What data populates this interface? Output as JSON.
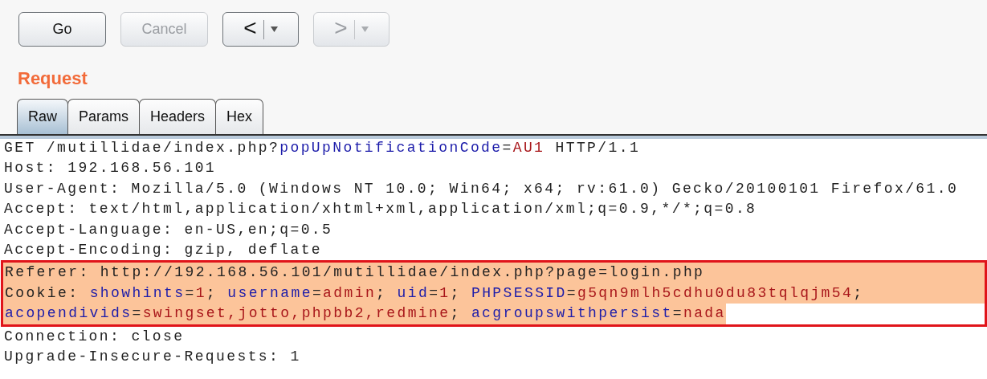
{
  "toolbar": {
    "buttons": [
      {
        "kind": "text",
        "label": "Go",
        "disabled": false
      },
      {
        "kind": "text",
        "label": "Cancel",
        "disabled": true
      },
      {
        "kind": "history",
        "label": "<",
        "disabled": false
      },
      {
        "kind": "history",
        "label": ">",
        "disabled": true
      }
    ]
  },
  "request": {
    "title": "Request",
    "tabs": [
      {
        "label": "Raw",
        "selected": true
      },
      {
        "label": "Params",
        "selected": false
      },
      {
        "label": "Headers",
        "selected": false
      },
      {
        "label": "Hex",
        "selected": false
      }
    ],
    "lines": [
      {
        "segments": [
          {
            "kind": "plain",
            "t": "GET /mutillidae/index.php?"
          },
          {
            "kind": "name",
            "t": "popUpNotificationCode"
          },
          {
            "kind": "plain",
            "t": "="
          },
          {
            "kind": "value",
            "t": "AU1"
          },
          {
            "kind": "plain",
            "t": " HTTP/1.1"
          }
        ]
      },
      {
        "segments": [
          {
            "kind": "plain",
            "t": "Host: 192.168.56.101"
          }
        ]
      },
      {
        "segments": [
          {
            "kind": "plain",
            "t": "User-Agent: Mozilla/5.0 (Windows NT 10.0; Win64; x64; rv:61.0) Gecko/20100101 Firefox/61.0"
          }
        ]
      },
      {
        "segments": [
          {
            "kind": "plain",
            "t": "Accept: text/html,application/xhtml+xml,application/xml;q=0.9,*/*;q=0.8"
          }
        ]
      },
      {
        "segments": [
          {
            "kind": "plain",
            "t": "Accept-Language: en-US,en;q=0.5"
          }
        ]
      },
      {
        "segments": [
          {
            "kind": "plain",
            "t": "Accept-Encoding: gzip, deflate"
          }
        ]
      }
    ],
    "highlighted_lines": [
      {
        "segments": [
          {
            "kind": "plain",
            "t": "Referer: http://192.168.56.101/mutillidae/index.php?page=login.php"
          }
        ]
      },
      {
        "segments": [
          {
            "kind": "plain",
            "t": "Cookie: "
          },
          {
            "kind": "name",
            "t": "showhints"
          },
          {
            "kind": "plain",
            "t": "="
          },
          {
            "kind": "value",
            "t": "1"
          },
          {
            "kind": "plain",
            "t": "; "
          },
          {
            "kind": "name",
            "t": "username"
          },
          {
            "kind": "plain",
            "t": "="
          },
          {
            "kind": "value",
            "t": "admin"
          },
          {
            "kind": "plain",
            "t": "; "
          },
          {
            "kind": "name",
            "t": "uid"
          },
          {
            "kind": "plain",
            "t": "="
          },
          {
            "kind": "value",
            "t": "1"
          },
          {
            "kind": "plain",
            "t": "; "
          },
          {
            "kind": "name",
            "t": "PHPSESSID"
          },
          {
            "kind": "plain",
            "t": "="
          },
          {
            "kind": "value",
            "t": "g5qn9mlh5cdhu0du83tqlqjm54"
          },
          {
            "kind": "plain",
            "t": ";"
          }
        ]
      },
      {
        "segments": [
          {
            "kind": "name",
            "t": "acopendivids"
          },
          {
            "kind": "plain",
            "t": "="
          },
          {
            "kind": "value",
            "t": "swingset,jotto,phpbb2,redmine"
          },
          {
            "kind": "plain",
            "t": "; "
          },
          {
            "kind": "name",
            "t": "acgroupswithpersist"
          },
          {
            "kind": "plain",
            "t": "="
          },
          {
            "kind": "value",
            "t": "nada"
          }
        ]
      }
    ],
    "trailing_lines": [
      {
        "segments": [
          {
            "kind": "plain",
            "t": "Connection: close"
          }
        ]
      },
      {
        "segments": [
          {
            "kind": "plain",
            "t": "Upgrade-Insecure-Requests: 1"
          }
        ]
      }
    ]
  }
}
